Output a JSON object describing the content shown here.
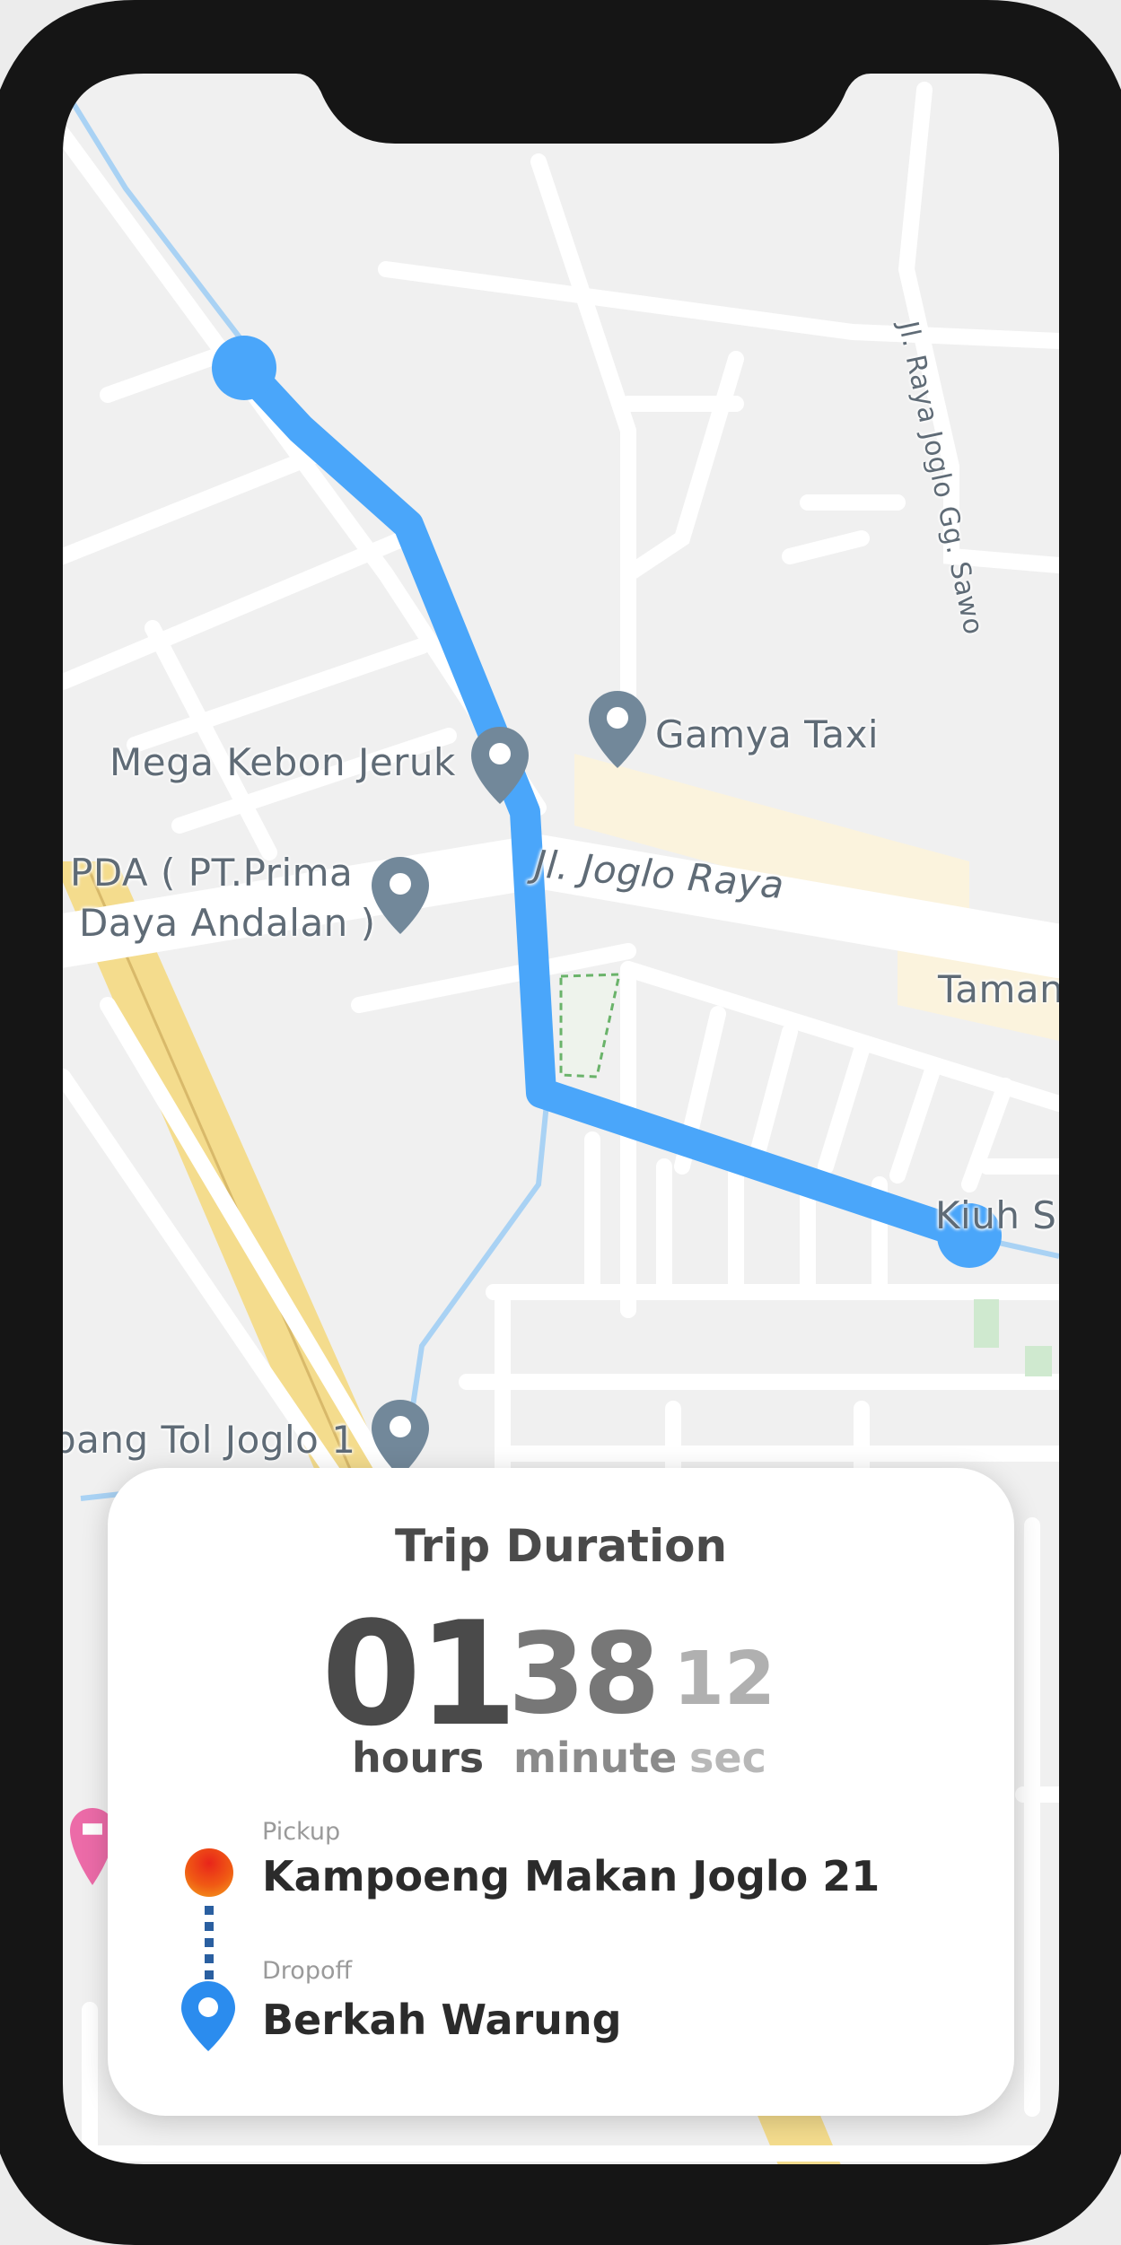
{
  "map": {
    "labels": {
      "mega_kebon_jeruk": "Mega Kebon Jeruk",
      "gamya_taxi": "Gamya Taxi",
      "pda_line1": "PDA ( PT.Prima",
      "pda_line2": "Daya Andalan )",
      "jl_joglo_raya": "Jl. Joglo Raya",
      "jl_raya_joglo_gg_sawo": "Jl. Raya Joglo Gg. Sawo",
      "taman": "Taman",
      "tol_joglo": "bang Tol Joglo 1",
      "kiri_s": "Kiuh S"
    }
  },
  "trip": {
    "title": "Trip Duration",
    "hours_value": "01",
    "minute_value": "38",
    "sec_value": "12",
    "hours_label": "hours",
    "minute_label": "minute",
    "sec_label": "sec"
  },
  "pickup": {
    "caption": "Pickup",
    "name": "Kampoeng Makan Joglo 21"
  },
  "dropoff": {
    "caption": "Dropoff",
    "name": "Berkah Warung"
  },
  "colors": {
    "route": "#4aa6fa",
    "frame": "#151515",
    "pickup": "#ee3e15",
    "dropoff": "#2b8cee"
  }
}
